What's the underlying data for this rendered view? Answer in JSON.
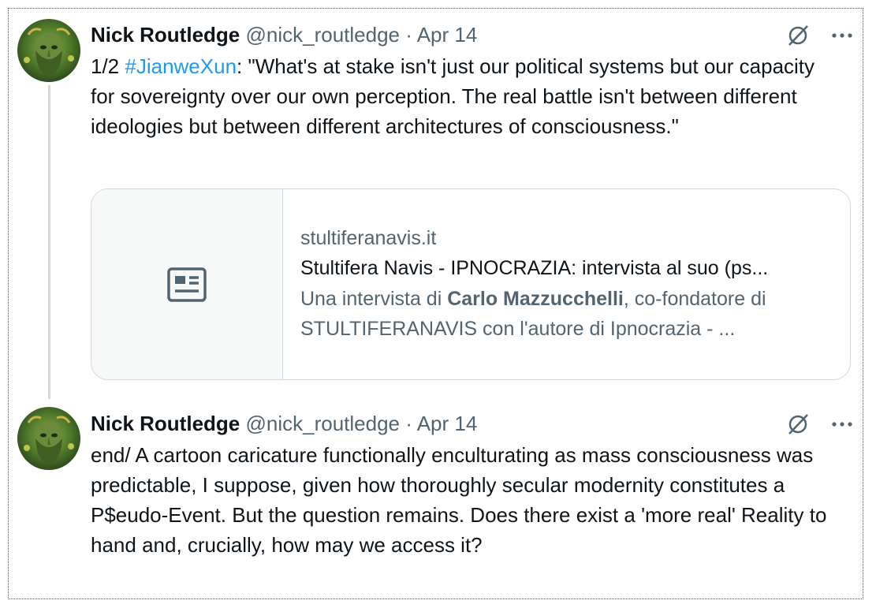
{
  "tweets": [
    {
      "author_name": "Nick Routledge",
      "handle": "@nick_routledge",
      "separator": "·",
      "date": "Apr 14",
      "text_prefix": "1/2 ",
      "hashtag": "#JianweXun",
      "text_body": ": \"What's at stake isn't just our political systems but our capacity for sovereignty over our own perception. The real battle isn't between different ideologies but between different architectures of consciousness.\"",
      "card": {
        "domain": "stultiferanavis.it",
        "title": "Stultifera Navis - IPNOCRAZIA: intervista al suo (ps...",
        "desc_prefix": "Una intervista di ",
        "desc_bold": "Carlo Mazzucchelli",
        "desc_suffix": ", co-fondatore di STULTIFERANAVIS con l'autore di Ipnocrazia - ...",
        "thumb_icon": "article-icon"
      }
    },
    {
      "author_name": "Nick Routledge",
      "handle": "@nick_routledge",
      "separator": "·",
      "date": "Apr 14",
      "text": "end/ A cartoon caricature functionally enculturating as mass consciousness was predictable, I suppose, given how thoroughly secular modernity constitutes a P$eudo-Event. But the question remains. Does there exist a 'more real' Reality to hand and, crucially, how may we access it?"
    }
  ],
  "icons": {
    "grok": "grok-icon",
    "more": "more-icon"
  },
  "colors": {
    "text": "#0f1419",
    "secondary": "#536471",
    "link": "#1d9bf0",
    "border": "#cfd9de"
  }
}
